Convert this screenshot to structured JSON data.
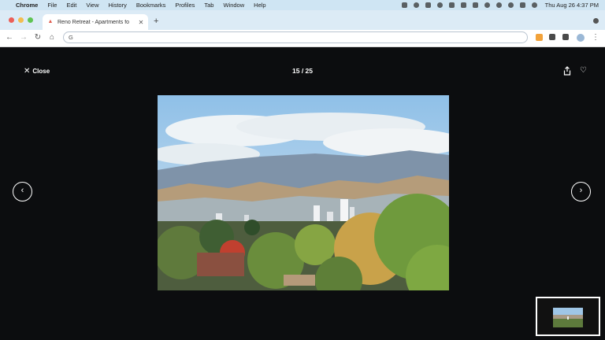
{
  "menubar": {
    "app_name": "Chrome",
    "items": [
      "File",
      "Edit",
      "View",
      "History",
      "Bookmarks",
      "Profiles",
      "Tab",
      "Window",
      "Help"
    ],
    "datetime": "Thu Aug 26  4:37 PM"
  },
  "browser": {
    "tab_title": "Reno Retreat - Apartments fo",
    "address_value": "G"
  },
  "viewer": {
    "close_label": "Close",
    "counter": "15 / 25"
  },
  "colors": {
    "background": "#0c0d0f",
    "sky": "#9fc6e6",
    "foliage": "#6f9a3d",
    "autumn": "#c9a24a"
  }
}
